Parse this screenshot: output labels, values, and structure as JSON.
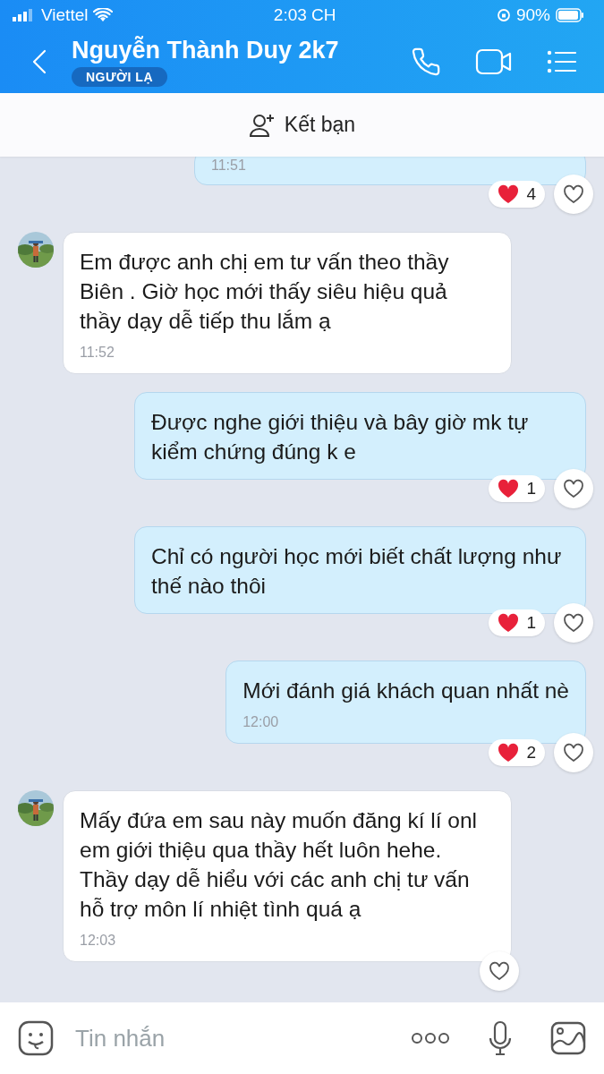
{
  "status_bar": {
    "carrier": "Viettel",
    "time": "2:03 CH",
    "battery": "90%"
  },
  "header": {
    "name": "Nguyễn Thành Duy 2k7",
    "badge": "NGƯỜI LẠ"
  },
  "add_friend": {
    "label": "Kết bạn"
  },
  "messages": [
    {
      "kind": "sent",
      "time": "11:51",
      "reactions": "4",
      "like_button": true
    },
    {
      "kind": "received",
      "text": "Em được anh chị em tư vấn theo thầy Biên . Giờ học mới thấy siêu hiệu quả thầy dạy dễ tiếp thu lắm ạ",
      "time": "11:52"
    },
    {
      "kind": "sent",
      "text": "Được nghe giới thiệu và bây giờ mk tự kiểm chứng đúng k e",
      "reactions": "1",
      "like_button": true
    },
    {
      "kind": "sent",
      "text": "Chỉ có người học mới biết chất lượng như thế nào thôi",
      "reactions": "1",
      "like_button": true
    },
    {
      "kind": "sent",
      "text": "Mới đánh giá khách quan nhất nè",
      "time": "12:00",
      "reactions": "2",
      "like_button": true
    },
    {
      "kind": "received",
      "text": "Mấy đứa em sau này muốn đăng kí lí onl em giới thiệu qua thầy hết luôn hehe. Thầy dạy dễ hiểu với các anh chị tư vấn hỗ trợ môn lí nhiệt tình quá ạ",
      "time": "12:03",
      "like_button": true
    }
  ],
  "composer": {
    "placeholder": "Tin nhắn"
  }
}
